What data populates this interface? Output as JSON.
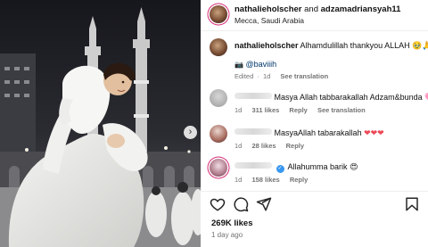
{
  "post": {
    "header": {
      "user1": "nathalieholscher",
      "conjunction": "and",
      "user2": "adzamadriansyah11",
      "location": "Mecca, Saudi Arabia"
    },
    "caption": {
      "username": "nathalieholscher",
      "text": "Alhamdulillah thankyou ALLAH",
      "emojis": "🥹🙏",
      "tag_icon": "📷",
      "tagged_user": "@baviiih",
      "meta_edited": "Edited",
      "meta_dot": "·",
      "meta_time": "1d",
      "see_translation": "See translation"
    },
    "comments": [
      {
        "text": "Masya Allah tabbarakallah Adzam&bunda",
        "trailing": "🩷",
        "time": "1d",
        "likes": "311 likes",
        "reply": "Reply",
        "translation": "See translation"
      },
      {
        "text": "MasyaAllah tabarakallah",
        "trailing": "❤❤❤",
        "time": "1d",
        "likes": "28 likes",
        "reply": "Reply"
      },
      {
        "text": "Allahumma barik",
        "trailing": "😍",
        "time": "1d",
        "likes": "158 likes",
        "reply": "Reply"
      }
    ],
    "likes": "269K likes",
    "time_ago": "1 day ago"
  },
  "icons": {
    "carousel_next": "chevron-right-icon",
    "like": "heart-icon",
    "comment": "comment-icon",
    "share": "share-icon",
    "save": "bookmark-icon",
    "comment_like": "heart-outline-icon"
  },
  "colors": {
    "verified": "#3897f0",
    "meta": "#737373",
    "story_ring": "#d62976",
    "hearts": "#ed4956"
  }
}
